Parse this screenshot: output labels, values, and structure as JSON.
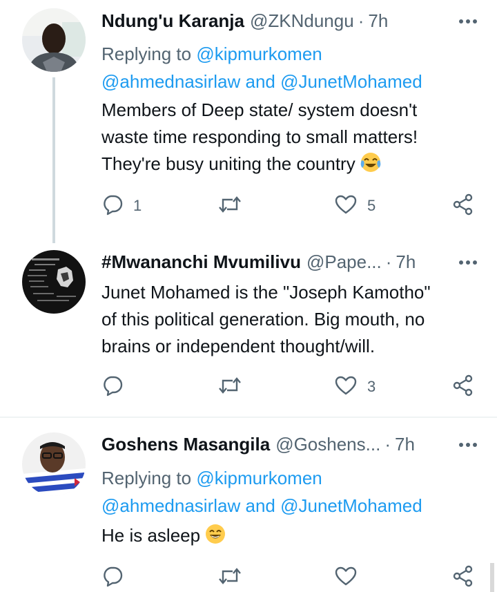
{
  "tweets": [
    {
      "name": "Ndung'u Karanja",
      "handle": "@ZKNdungu",
      "separator": "·",
      "time": "7h",
      "replying_prefix": "Replying to ",
      "reply_user_1": "@kipmurkomen",
      "reply_user_2": "@ahmednasirlaw",
      "reply_and": " and ",
      "reply_user_3": "@JunetMohamed",
      "text_lines": [
        "Members of Deep state/ system doesn't",
        "waste time responding to small matters!",
        "They're busy uniting the country"
      ],
      "emoji": "face-with-tears-of-joy",
      "reply_count": "1",
      "like_count": "5"
    },
    {
      "name": "#Mwananchi Mvumilivu",
      "handle": "@Pape...",
      "separator": "·",
      "time": "7h",
      "text_lines": [
        "Junet Mohamed is the \"Joseph Kamotho\"",
        "of this political generation. Big mouth, no",
        "brains or independent thought/will."
      ],
      "like_count": "3"
    },
    {
      "name": "Goshens Masangila",
      "handle": "@Goshens...",
      "separator": "·",
      "time": "7h",
      "replying_prefix": "Replying to ",
      "reply_user_1": "@kipmurkomen",
      "reply_user_2": "@ahmednasirlaw",
      "reply_and": " and ",
      "reply_user_3": "@JunetMohamed",
      "text_lines": [
        "He is asleep"
      ],
      "emoji": "grinning-face-with-smiling-eyes"
    }
  ],
  "colors": {
    "link": "#1d9bf0",
    "secondary_text": "#536471",
    "primary_text": "#0f1419",
    "thread_line": "#cfd9de",
    "divider": "#eff3f4"
  },
  "icons": {
    "reply": "reply-icon",
    "retweet": "retweet-icon",
    "like": "heart-icon",
    "share": "share-icon",
    "more": "more-icon"
  }
}
